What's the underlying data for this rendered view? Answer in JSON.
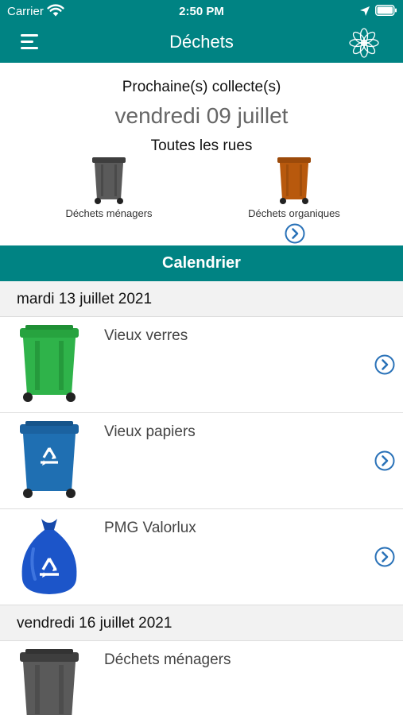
{
  "status_bar": {
    "carrier": "Carrier",
    "time": "2:50 PM"
  },
  "nav": {
    "title": "Déchets",
    "menu_icon": "hamburger-menu-icon",
    "logo_icon": "flower-logo-icon"
  },
  "next_collection": {
    "heading": "Prochaine(s) collecte(s)",
    "date": "vendredi 09 juillet",
    "streets": "Toutes les rues",
    "bins": [
      {
        "label": "Déchets ménagers",
        "color": "#5a5a5a",
        "icon": "grey-bin-icon"
      },
      {
        "label": "Déchets organiques",
        "color": "#b8590d",
        "icon": "brown-bin-icon"
      }
    ]
  },
  "calendar": {
    "title": "Calendrier",
    "days": [
      {
        "date": "mardi 13 juillet 2021",
        "items": [
          {
            "label": "Vieux verres",
            "icon": "green-glass-bin-icon",
            "color": "#2fb34a"
          },
          {
            "label": "Vieux papiers",
            "icon": "blue-recycle-bin-icon",
            "color": "#1f6fb2"
          },
          {
            "label": "PMG Valorlux",
            "icon": "blue-recycle-bag-icon",
            "color": "#1c55c9"
          }
        ]
      },
      {
        "date": "vendredi 16 juillet 2021",
        "items": [
          {
            "label": "Déchets ménagers",
            "icon": "grey-bin-icon",
            "color": "#5a5a5a"
          }
        ]
      }
    ]
  },
  "colors": {
    "teal": "#008383",
    "chevron": "#2a72b8",
    "divider": "#dddddd",
    "date_row_bg": "#f2f2f2"
  }
}
